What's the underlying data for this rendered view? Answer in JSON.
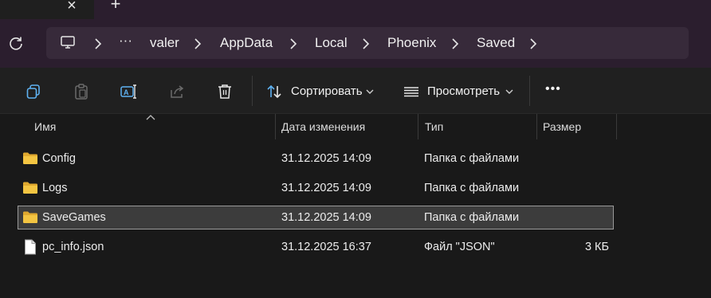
{
  "window": {
    "close_glyph": "×",
    "new_tab_glyph": "+"
  },
  "address": {
    "overflow": "···",
    "crumbs": [
      "valer",
      "AppData",
      "Local",
      "Phoenix",
      "Saved"
    ]
  },
  "toolbar": {
    "sort_label": "Сортировать",
    "view_label": "Просмотреть",
    "more_label": "•••"
  },
  "columns": {
    "name": "Имя",
    "date": "Дата изменения",
    "type": "Тип",
    "size": "Размер"
  },
  "files": [
    {
      "name": "Config",
      "date": "31.12.2025 14:09",
      "type": "Папка с файлами",
      "size": "",
      "kind": "folder"
    },
    {
      "name": "Logs",
      "date": "31.12.2025 14:09",
      "type": "Папка с файлами",
      "size": "",
      "kind": "folder"
    },
    {
      "name": "SaveGames",
      "date": "31.12.2025 14:09",
      "type": "Папка с файлами",
      "size": "",
      "kind": "folder",
      "selected": true
    },
    {
      "name": "pc_info.json",
      "date": "31.12.2025 16:37",
      "type": "Файл \"JSON\"",
      "size": "3 КБ",
      "kind": "file"
    }
  ],
  "colors": {
    "accent_bar": "#2b1e2e",
    "folder": "#f4c542",
    "background": "#191919"
  }
}
